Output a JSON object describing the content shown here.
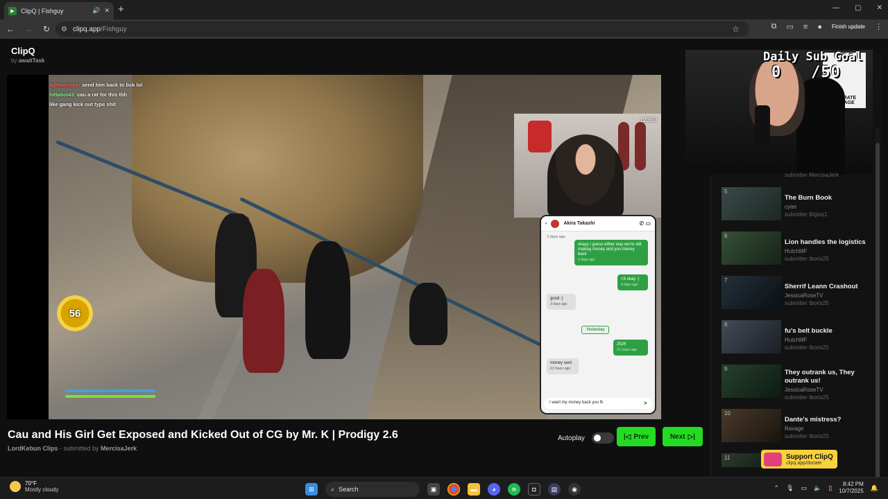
{
  "browser": {
    "tab_title": "ClipQ | Fishguy",
    "url_host": "clipq.app",
    "url_path": "/Fishguy",
    "update_label": "Finish update"
  },
  "site": {
    "logo": "ClipQ",
    "byline_prefix": "by",
    "byline_author": "awaitTask"
  },
  "video": {
    "chat_lines": [
      {
        "user": "lightocrispy:",
        "text": "send him back to bsk lol"
      },
      {
        "user": "hittaboi43:",
        "text": "cau a rat for this tbh"
      },
      {
        "user": "",
        "text": "like gang kick out type shit"
      }
    ],
    "viewer_count": "12360",
    "coin_value": "56",
    "phone": {
      "contact": "Akira Takashi",
      "time_top": "3 days ago",
      "messages": [
        {
          "dir": "out",
          "text": "okayy i guess either way we're still making money and you money back",
          "ts": "3 days ago"
        },
        {
          "dir": "out",
          "text": "<3 okay :)",
          "ts": "3 days ago"
        },
        {
          "dir": "in",
          "text": "good :)",
          "ts": "3 days ago"
        },
        {
          "dir": "out",
          "text": "2526",
          "ts": "21 hours ago"
        },
        {
          "dir": "in",
          "text": "money sent",
          "ts": "21 hours ago"
        }
      ],
      "divider": "Yesterday",
      "input_text": "I want my money back you fk"
    },
    "title": "Cau and His Girl Get Exposed and Kicked Out of CG by Mr. K | Prodigy 2.6",
    "channel": "LordKebun Clips",
    "submitted_prefix": "- submitted by",
    "submitter": "MercisaJerk"
  },
  "controls": {
    "autoplay_label": "Autoplay",
    "prev_label": "Prev",
    "next_label": "Next"
  },
  "overlay": {
    "sub_goal_title": "Daily Sub Goal",
    "sub_goal_count": "0",
    "sub_goal_target": "/50",
    "poster_text": "CORPORATE ESPIONAGE"
  },
  "queue": {
    "prev_submitter": "submitter MercisaJerk",
    "items": [
      {
        "num": "5",
        "title": "The Burn Book",
        "channel": "cyter",
        "submitter": "submitter Bigtaz1"
      },
      {
        "num": "6",
        "title": "Lion handles the logistics",
        "channel": "HutchMF",
        "submitter": "submitter tboris25"
      },
      {
        "num": "7",
        "title": "Sherrif Leann Crashout",
        "channel": "JessicaRoseTV",
        "submitter": "submitter tboris25"
      },
      {
        "num": "8",
        "title": "fu's belt buckle",
        "channel": "HutchMF",
        "submitter": "submitter tboris25"
      },
      {
        "num": "9",
        "title": "They outrank us, They outrank us!",
        "channel": "JessicaRoseTV",
        "submitter": "submitter tboris25"
      },
      {
        "num": "10",
        "title": "Dante's mistress?",
        "channel": "Ravage",
        "submitter": "submitter tboris25"
      },
      {
        "num": "11",
        "title": "",
        "channel": "",
        "submitter": ""
      }
    ]
  },
  "support": {
    "label": "Support ClipQ",
    "url": "clipq.app/donate"
  },
  "taskbar": {
    "temp": "70°F",
    "weather": "Mostly cloudy",
    "search": "Search",
    "time": "8:42 PM",
    "date": "10/7/2025"
  }
}
